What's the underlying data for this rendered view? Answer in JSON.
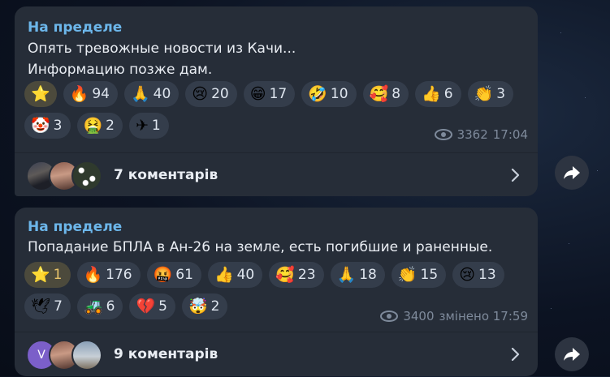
{
  "messages": [
    {
      "sender": "На пределе",
      "lines": [
        "Опять тревожные новости из Качи...",
        "Информацию позже дам."
      ],
      "reactions": [
        {
          "icon": "star",
          "emoji": "⭐",
          "count": ""
        },
        {
          "icon": "fire",
          "emoji": "🔥",
          "count": "94"
        },
        {
          "icon": "folded-hands",
          "emoji": "🙏",
          "count": "40"
        },
        {
          "icon": "crying-face",
          "emoji": "😢",
          "count": "20"
        },
        {
          "icon": "grinning-face",
          "emoji": "😁",
          "count": "17"
        },
        {
          "icon": "rofl-face",
          "emoji": "🤣",
          "count": "10"
        },
        {
          "icon": "smiling-hearts-face",
          "emoji": "🥰",
          "count": "8"
        },
        {
          "icon": "thumbs-up",
          "emoji": "👍",
          "count": "6"
        },
        {
          "icon": "clapping-hands",
          "emoji": "👏",
          "count": "3"
        },
        {
          "icon": "clown-face",
          "emoji": "🤡",
          "count": "3"
        },
        {
          "icon": "vomiting-face",
          "emoji": "🤮",
          "count": "2"
        },
        {
          "icon": "airplane",
          "emoji": "✈",
          "count": "1"
        }
      ],
      "views": "3362",
      "time": "17:04",
      "comments": "7 коментарів"
    },
    {
      "sender": "На пределе",
      "lines": [
        "Попадание БПЛА в Ан-26 на земле, есть погибшие и раненные."
      ],
      "reactions": [
        {
          "icon": "star",
          "emoji": "⭐",
          "count": "1"
        },
        {
          "icon": "fire",
          "emoji": "🔥",
          "count": "176"
        },
        {
          "icon": "cursing-face",
          "emoji": "🤬",
          "count": "61"
        },
        {
          "icon": "thumbs-up",
          "emoji": "👍",
          "count": "40"
        },
        {
          "icon": "smiling-hearts-face",
          "emoji": "🥰",
          "count": "23"
        },
        {
          "icon": "folded-hands",
          "emoji": "🙏",
          "count": "18"
        },
        {
          "icon": "clapping-hands",
          "emoji": "👏",
          "count": "15"
        },
        {
          "icon": "crying-face",
          "emoji": "😢",
          "count": "13"
        },
        {
          "icon": "dove",
          "emoji": "🕊",
          "count": "7"
        },
        {
          "icon": "tank-image",
          "emoji": "🚜",
          "count": "6"
        },
        {
          "icon": "broken-heart",
          "emoji": "💔",
          "count": "5"
        },
        {
          "icon": "exploding-head",
          "emoji": "🤯",
          "count": "2"
        }
      ],
      "views": "3400",
      "time": "змінено 17:59",
      "comments": "9 коментарів",
      "avatar_letter": "V"
    }
  ],
  "colors": {
    "sender": "#6cb6ea",
    "bubble": "#262d38",
    "pill": "#343d4b",
    "active": "#e9c46a"
  }
}
